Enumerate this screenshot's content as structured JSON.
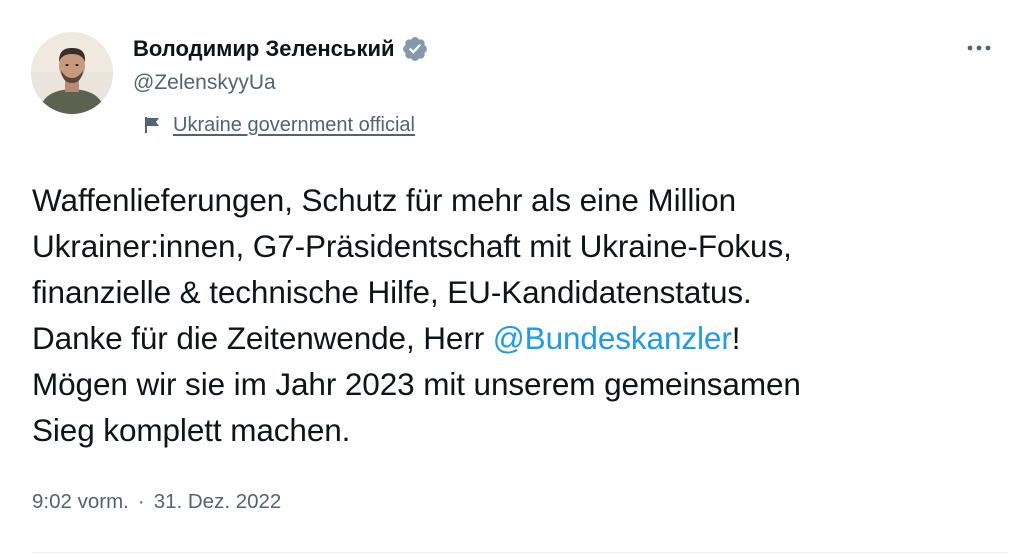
{
  "author": {
    "display_name": "Володимир Зеленський",
    "handle": "@ZelenskyyUa",
    "verified": true,
    "label": "Ukraine government official"
  },
  "tweet": {
    "line1": "Waffenlieferungen, Schutz für mehr als eine Million",
    "line2": "Ukrainer:innen, G7-Präsidentschaft mit Ukraine-Fokus,",
    "line3": "finanzielle & technische Hilfe, EU-Kandidatenstatus.",
    "line4_before": "Danke für die Zeitenwende, Herr ",
    "line4_mention": "@Bundeskanzler",
    "line4_after": "!",
    "line5": "Mögen wir sie im Jahr 2023 mit unserem gemeinsamen",
    "line6": "Sieg komplett machen."
  },
  "meta": {
    "time": "9:02 vorm.",
    "separator": "·",
    "date": "31. Dez. 2022"
  },
  "colors": {
    "text": "#0f1419",
    "secondary": "#536471",
    "link": "#1d9bf0",
    "verified_badge": "#829aab"
  },
  "icons": {
    "verified": "verified-badge-icon",
    "flag": "flag-icon",
    "more": "more-horizontal-icon"
  }
}
